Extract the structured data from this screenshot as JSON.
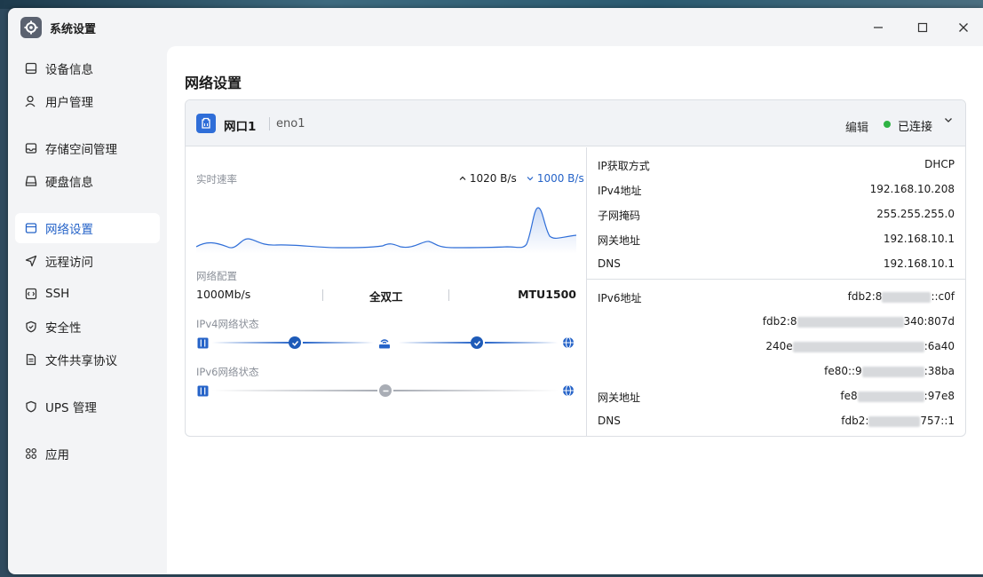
{
  "window": {
    "title": "系统设置"
  },
  "sidebar": {
    "items": [
      {
        "label": "设备信息",
        "icon": "device-icon"
      },
      {
        "label": "用户管理",
        "icon": "user-icon"
      },
      {
        "label": "存储空间管理",
        "icon": "storage-icon"
      },
      {
        "label": "硬盘信息",
        "icon": "disk-icon"
      },
      {
        "label": "网络设置",
        "icon": "network-icon",
        "active": true
      },
      {
        "label": "远程访问",
        "icon": "remote-icon"
      },
      {
        "label": "SSH",
        "icon": "ssh-icon"
      },
      {
        "label": "安全性",
        "icon": "shield-icon"
      },
      {
        "label": "文件共享协议",
        "icon": "file-share-icon"
      },
      {
        "label": "UPS 管理",
        "icon": "ups-icon"
      },
      {
        "label": "应用",
        "icon": "apps-icon"
      }
    ]
  },
  "page": {
    "title": "网络设置"
  },
  "port": {
    "name": "网口1",
    "device": "eno1",
    "edit_label": "编辑",
    "status_label": "已连接",
    "status_color": "#2fb344"
  },
  "speed": {
    "label": "实时速率",
    "up": "1020 B/s",
    "down": "1000 B/s"
  },
  "config": {
    "label": "网络配置",
    "speed": "1000Mb/s",
    "duplex": "全双工",
    "mtu": "MTU1500"
  },
  "ipv4_status": {
    "label": "IPv4网络状态"
  },
  "ipv6_status": {
    "label": "IPv6网络状态"
  },
  "ipv4": {
    "method_label": "IP获取方式",
    "method": "DHCP",
    "addr_label": "IPv4地址",
    "addr": "192.168.10.208",
    "mask_label": "子网掩码",
    "mask": "255.255.255.0",
    "gateway_label": "网关地址",
    "gateway": "192.168.10.1",
    "dns_label": "DNS",
    "dns": "192.168.10.1"
  },
  "ipv6": {
    "addr_label": "IPv6地址",
    "addr1_a": "fdb2:8",
    "addr1_b": "::c0f",
    "addr2_a": "fdb2:8",
    "addr2_b": "340:807d",
    "addr3_a": "240e",
    "addr3_b": ":6a40",
    "addr4_a": "fe80::9",
    "addr4_b": ":38ba",
    "gateway_label": "网关地址",
    "gateway_a": "fe8",
    "gateway_b": ":97e8",
    "dns_label": "DNS",
    "dns_a": "fdb2:",
    "dns_b": "757::1"
  },
  "colors": {
    "accent": "#2563c8",
    "active_bg": "#ffffff"
  }
}
